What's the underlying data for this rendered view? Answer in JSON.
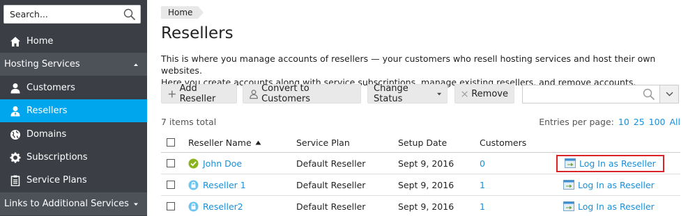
{
  "sidebar": {
    "search": {
      "placeholder": "Search..."
    },
    "items": [
      {
        "label": "Home",
        "icon": "home-icon"
      },
      {
        "label": "Hosting Services",
        "section": true
      },
      {
        "label": "Customers",
        "icon": "user-icon"
      },
      {
        "label": "Resellers",
        "icon": "reseller-icon",
        "active": true
      },
      {
        "label": "Domains",
        "icon": "globe-icon"
      },
      {
        "label": "Subscriptions",
        "icon": "gear-icon"
      },
      {
        "label": "Service Plans",
        "icon": "clipboard-icon"
      },
      {
        "label": "Links to Additional Services",
        "section": true
      }
    ]
  },
  "breadcrumb": {
    "home": "Home"
  },
  "page": {
    "title": "Resellers",
    "description_line1": "This is where you manage accounts of resellers — your customers who resell hosting services and host their own websites.",
    "description_line2": "Here you create accounts along with service subscriptions, manage existing resellers, and remove accounts."
  },
  "toolbar": {
    "add_reseller": "Add Reseller",
    "convert": "Convert to Customers",
    "change_status": "Change Status",
    "remove": "Remove",
    "search_placeholder": ""
  },
  "list": {
    "total": "7 items total",
    "entries_label": "Entries per page:",
    "page_sizes": [
      "10",
      "25",
      "100",
      "All"
    ],
    "columns": {
      "name": "Reseller Name",
      "plan": "Service Plan",
      "date": "Setup Date",
      "customers": "Customers"
    },
    "rows": [
      {
        "name": "John Doe",
        "status": "active",
        "plan": "Default Reseller",
        "date": "Sept 9, 2016",
        "customers": "0",
        "login": "Log In as Reseller"
      },
      {
        "name": "Reseller 1",
        "status": "locked",
        "plan": "Default Reseller",
        "date": "Sept 9, 2016",
        "customers": "1",
        "login": "Log In as Reseller"
      },
      {
        "name": "Reseller2",
        "status": "locked",
        "plan": "Default Reseller",
        "date": "Sept 9, 2016",
        "customers": "1",
        "login": "Log In as Reseller"
      }
    ]
  },
  "colors": {
    "sidebar_bg": "#3b3f45",
    "active_item": "#00a6ed",
    "link": "#1a8fd8",
    "highlight_border": "#d9252a",
    "status_active": "#8ab31c",
    "status_locked": "#6cc4f0"
  }
}
